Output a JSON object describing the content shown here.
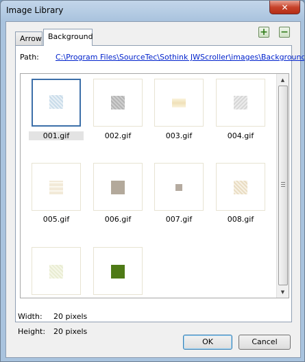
{
  "window": {
    "title": "Image Library"
  },
  "tabs": [
    {
      "label": "Arrow"
    },
    {
      "label": "Background"
    }
  ],
  "toolbar": {
    "add_glyph": "+",
    "remove_glyph": "−"
  },
  "path": {
    "label": "Path:",
    "value": "C:\\Program Files\\SourceTec\\Sothink JWScroller\\images\\Background"
  },
  "images": [
    {
      "name": "001.gif",
      "selected": true
    },
    {
      "name": "002.gif"
    },
    {
      "name": "003.gif"
    },
    {
      "name": "004.gif"
    },
    {
      "name": "005.gif"
    },
    {
      "name": "006.gif"
    },
    {
      "name": "007.gif"
    },
    {
      "name": "008.gif"
    },
    {
      "name": ""
    },
    {
      "name": ""
    }
  ],
  "info": {
    "width_label": "Width:",
    "width_value": "20 pixels",
    "height_label": "Height:",
    "height_value": "20 pixels"
  },
  "buttons": {
    "ok": "OK",
    "cancel": "Cancel"
  },
  "colors": {
    "selection": "#3b6ea8",
    "link": "#0022cc"
  }
}
